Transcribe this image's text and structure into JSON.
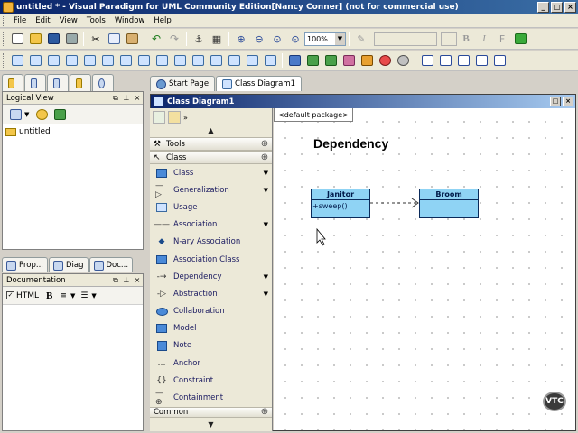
{
  "window": {
    "title": "untitled * - Visual Paradigm for UML Community Edition[Nancy Conner] (not for commercial use)"
  },
  "menu": [
    "File",
    "Edit",
    "View",
    "Tools",
    "Window",
    "Help"
  ],
  "toolbar": {
    "zoom": "100%",
    "bold": "B",
    "italic": "I"
  },
  "editor_tabs": [
    "Start Page",
    "Class Diagram1"
  ],
  "logical_view": {
    "title": "Logical View",
    "tree": [
      "untitled"
    ]
  },
  "bottom_tabs": [
    "Prop...",
    "Diag",
    "Doc..."
  ],
  "documentation": {
    "title": "Documentation",
    "html_label": "HTML",
    "bold": "B"
  },
  "diagram_window": {
    "title": "Class Diagram1"
  },
  "palette": {
    "sections": {
      "tools": "Tools",
      "class": "Class",
      "common": "Common"
    },
    "items": [
      {
        "label": "Class",
        "dropdown": true
      },
      {
        "label": "Generalization",
        "dropdown": true
      },
      {
        "label": "Usage",
        "dropdown": false
      },
      {
        "label": "Association",
        "dropdown": true
      },
      {
        "label": "N-ary Association",
        "dropdown": false
      },
      {
        "label": "Association Class",
        "dropdown": false
      },
      {
        "label": "Dependency",
        "dropdown": true
      },
      {
        "label": "Abstraction",
        "dropdown": true
      },
      {
        "label": "Collaboration",
        "dropdown": false
      },
      {
        "label": "Model",
        "dropdown": false
      },
      {
        "label": "Note",
        "dropdown": false
      },
      {
        "label": "Anchor",
        "dropdown": false
      },
      {
        "label": "Constraint",
        "dropdown": false
      },
      {
        "label": "Containment",
        "dropdown": false
      }
    ]
  },
  "canvas": {
    "package_tab": "<default package>",
    "diagram_title": "Dependency",
    "classes": [
      {
        "name": "Janitor",
        "operation": "+sweep()"
      },
      {
        "name": "Broom",
        "operation": ""
      }
    ],
    "watermark": "VTC"
  }
}
